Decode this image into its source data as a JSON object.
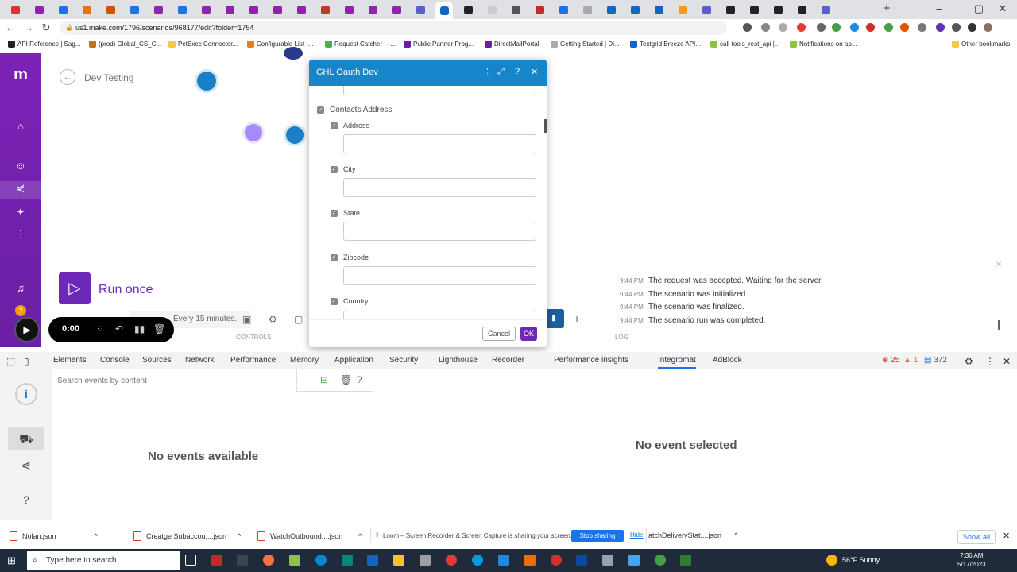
{
  "browser": {
    "tab_colors": [
      "#d33",
      "#8e24aa",
      "#1a73e8",
      "#e8711a",
      "#d35400",
      "#1a73e8",
      "#8e24aa",
      "#1a73e8",
      "#8e24aa",
      "#8e24aa",
      "#8e24aa",
      "#8e24aa",
      "#8e24aa",
      "#c0392b",
      "#8e24aa",
      "#8e24aa",
      "#8e24aa",
      "#5b5fc7",
      "#1565c0",
      "#222",
      "#ccc",
      "#555",
      "#c62828",
      "#1a73e8",
      "#aaa",
      "#1565c0",
      "#1565c0",
      "#1565c0",
      "#f39c12",
      "#5b5fc7",
      "#222",
      "#222",
      "#222",
      "#222",
      "#5b5fc7"
    ],
    "url": "us1.make.com/1796/scenarios/968177/edit?folder=1754",
    "bookmarks": [
      "API Reference | Sag...",
      "(prod) Global_CS_C...",
      "PetExec Connector...",
      "Configurable List -...",
      "Request Catcher —...",
      "Public Partner Prog...",
      "DirectMailPortal",
      "Getting Started | Di...",
      "Textgrid Breeze API...",
      "call-tools_rest_api |...",
      "Notifications on ap..."
    ],
    "other_bookmarks": "Other bookmarks"
  },
  "scenario": {
    "name": "Dev Testing",
    "run_label": "Run once",
    "schedule_text": "Every 15 minutes.",
    "controls_label": "CONTROLS",
    "log_label": "LOG",
    "log": [
      {
        "time": "9:44 PM",
        "text": "The request was accepted. Waiting for the server."
      },
      {
        "time": "9:44 PM",
        "text": "The scenario was initialized."
      },
      {
        "time": "9:44 PM",
        "text": "The scenario was finalized."
      },
      {
        "time": "9:44 PM",
        "text": "The scenario run was completed."
      }
    ]
  },
  "loom": {
    "time": "0:00"
  },
  "dialog": {
    "title": "GHL Oauth Dev",
    "section": "Contacts Address",
    "fields": [
      "Address",
      "City",
      "State",
      "Zipcode",
      "Country"
    ],
    "cancel": "Cancel",
    "ok": "OK"
  },
  "devtools": {
    "tabs": [
      "Elements",
      "Console",
      "Sources",
      "Network",
      "Performance",
      "Memory",
      "Application",
      "Security",
      "Lighthouse",
      "Recorder",
      "Performance insights",
      "Integromat",
      "AdBlock"
    ],
    "errors": "25",
    "warnings": "1",
    "infos": "372",
    "search_placeholder": "Search events by content",
    "no_events": "No events available",
    "no_selected": "No event selected"
  },
  "downloads": {
    "items": [
      "Nolan.json",
      "Creatge Subaccou....json",
      "WatchOutbound....json",
      "atchDeliveryStat....json"
    ],
    "share_text": "Loom – Screen Recorder & Screen Capture is sharing your screen.",
    "stop_sharing": "Stop sharing",
    "hide": "Hide",
    "show_all": "Show all"
  },
  "taskbar": {
    "search_placeholder": "Type here to search",
    "weather": "56°F Sunny",
    "time": "7:36 AM",
    "date": "5/17/2023"
  }
}
